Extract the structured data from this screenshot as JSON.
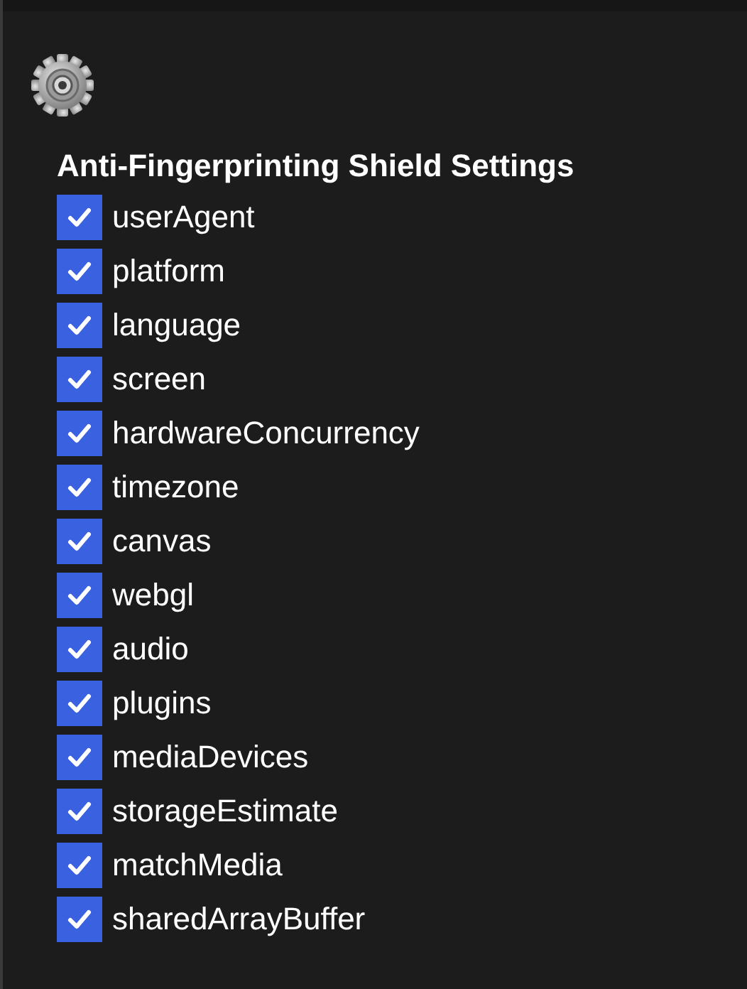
{
  "title": "Anti-Fingerprinting Shield Settings",
  "options": [
    {
      "label": "userAgent",
      "checked": true
    },
    {
      "label": "platform",
      "checked": true
    },
    {
      "label": "language",
      "checked": true
    },
    {
      "label": "screen",
      "checked": true
    },
    {
      "label": "hardwareConcurrency",
      "checked": true
    },
    {
      "label": "timezone",
      "checked": true
    },
    {
      "label": "canvas",
      "checked": true
    },
    {
      "label": "webgl",
      "checked": true
    },
    {
      "label": "audio",
      "checked": true
    },
    {
      "label": "plugins",
      "checked": true
    },
    {
      "label": "mediaDevices",
      "checked": true
    },
    {
      "label": "storageEstimate",
      "checked": true
    },
    {
      "label": "matchMedia",
      "checked": true
    },
    {
      "label": "sharedArrayBuffer",
      "checked": true
    }
  ]
}
